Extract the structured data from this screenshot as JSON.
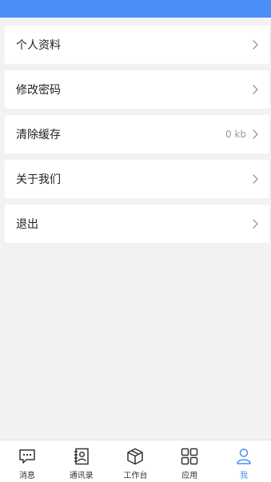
{
  "colors": {
    "header": "#4b8ef5",
    "active": "#4b8ef5",
    "background": "#f2f2f2"
  },
  "menu": {
    "items": [
      {
        "label": "个人资料",
        "value": ""
      },
      {
        "label": "修改密码",
        "value": ""
      },
      {
        "label": "清除缓存",
        "value": "0 kb"
      },
      {
        "label": "关于我们",
        "value": ""
      },
      {
        "label": "退出",
        "value": ""
      }
    ]
  },
  "tabbar": {
    "tabs": [
      {
        "label": "消息",
        "icon": "message-icon",
        "active": false
      },
      {
        "label": "通讯录",
        "icon": "contacts-icon",
        "active": false
      },
      {
        "label": "工作台",
        "icon": "cube-icon",
        "active": false
      },
      {
        "label": "应用",
        "icon": "apps-grid-icon",
        "active": false
      },
      {
        "label": "我",
        "icon": "user-icon",
        "active": true
      }
    ]
  }
}
